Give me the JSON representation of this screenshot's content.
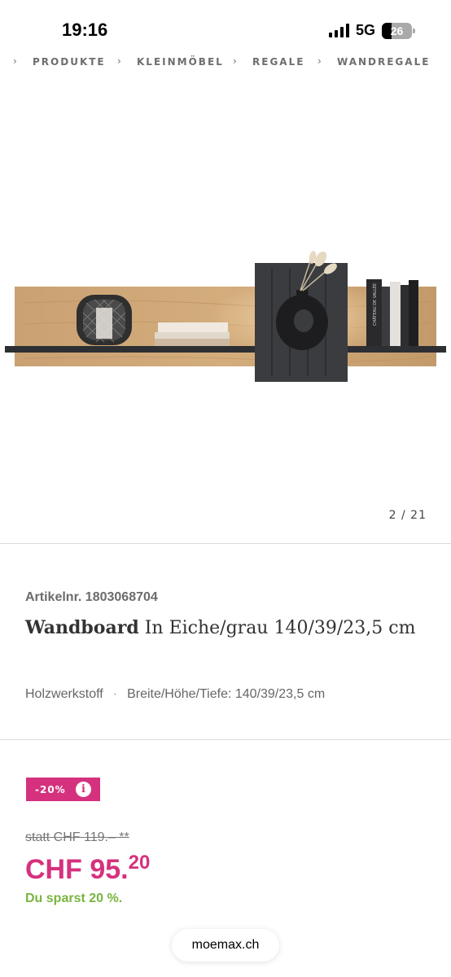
{
  "status_bar": {
    "time": "19:16",
    "network": "5G",
    "battery_level": "26"
  },
  "breadcrumb": [
    "PRODUKTE",
    "KLEINMÖBEL",
    "REGALE",
    "WANDREGALE"
  ],
  "gallery": {
    "counter": "2 / 21",
    "book_spine_text": "CHÂTEAU DE VALLÉE"
  },
  "product": {
    "article_nr": "Artikelnr. 1803068704",
    "name": "Wandboard",
    "subtitle": "In Eiche/grau 140/39/23,5 cm",
    "material": "Holzwerkstoff",
    "separator": "·",
    "dimensions": "Breite/Höhe/Tiefe: 140/39/23,5 cm"
  },
  "price": {
    "discount": "-20%",
    "info_icon": "info-icon",
    "old_price": "statt CHF 119.– **",
    "current_main": "CHF 95.",
    "current_cents": "20",
    "savings": "Du sparst 20 %."
  },
  "browser": {
    "url": "moemax.ch"
  },
  "colors": {
    "accent": "#d5317e",
    "savings": "#7ab441"
  }
}
